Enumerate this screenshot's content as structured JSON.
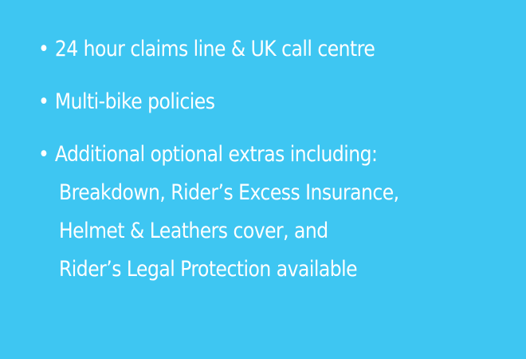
{
  "background_color": "#3ec6f2",
  "text_color": "#ffffff",
  "features": {
    "bullet": "•",
    "item1": "24 hour claims line & UK call centre",
    "item2": "Multi-bike policies",
    "item3": "Additional optional extras including:",
    "item3_lines": [
      "Breakdown, Rider’s Excess Insurance,",
      "Helmet & Leathers cover, and",
      "Rider’s Legal Protection available"
    ]
  }
}
